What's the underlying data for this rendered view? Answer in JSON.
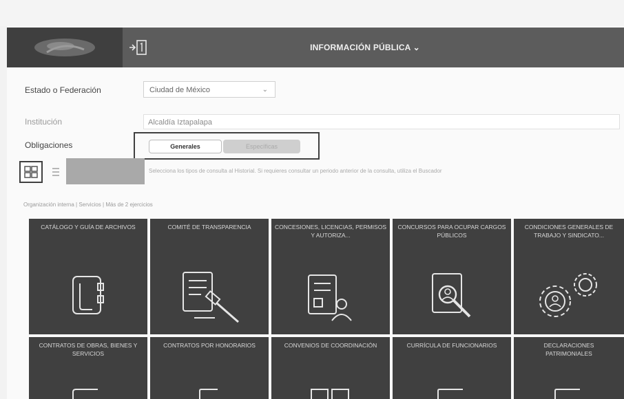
{
  "header": {
    "title": "INFORMACIÓN PÚBLICA ⌄",
    "logo_icon": "logo-image",
    "sidebar_toggle_icon": "sidebar-toggle-icon"
  },
  "filters": {
    "estado_label": "Estado o Federación",
    "estado_value": "Ciudad de México",
    "institucion_label": "Institución",
    "institucion_value": "Alcaldía Iztapalapa",
    "obligaciones_label": "Obligaciones",
    "tab_generales": "Generales",
    "tab_especificas": "Específicas"
  },
  "view": {
    "hint_text": "Selecciona los tipos de consulta al Historial. Si requieres consultar un periodo anterior de la consulta, utiliza el Buscador",
    "legend_text": "Organización interna | Servicios | Más de 2 ejercicios"
  },
  "tiles": [
    {
      "title": "CATÁLOGO Y GUÍA DE ARCHIVOS",
      "icon": "binder-icon"
    },
    {
      "title": "COMITÉ DE TRANSPARENCIA",
      "icon": "document-gavel-icon"
    },
    {
      "title": "CONCESIONES, LICENCIAS, PERMISOS Y AUTORIZA...",
      "icon": "document-person-icon"
    },
    {
      "title": "CONCURSOS PARA OCUPAR CARGOS PÚBLICOS",
      "icon": "document-search-icon"
    },
    {
      "title": "CONDICIONES GENERALES DE TRABAJO Y SINDICATO...",
      "icon": "gears-money-icon"
    },
    {
      "title": "CONTRATOS DE OBRAS, BIENES Y SERVICIOS",
      "icon": "contract-icon"
    },
    {
      "title": "CONTRATOS POR HONORARIOS",
      "icon": "contract-icon"
    },
    {
      "title": "CONVENIOS DE COORDINACIÓN",
      "icon": "agreement-icon"
    },
    {
      "title": "CURRÍCULA DE FUNCIONARIOS",
      "icon": "resume-icon"
    },
    {
      "title": "DECLARACIONES PATRIMONIALES",
      "icon": "declaration-icon"
    }
  ],
  "colors": {
    "header_bg": "#5c5c5c",
    "tile_bg": "#404040"
  }
}
